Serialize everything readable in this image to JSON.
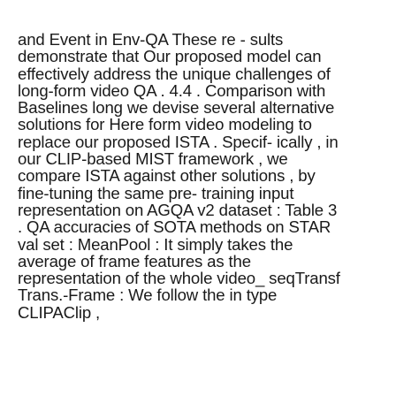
{
  "document": {
    "lines": [
      "and Event in Env-QA These re - sults",
      "demonstrate that Our proposed model can",
      "effectively address the unique challenges of",
      "long-form video QA . 4.4 . Comparison with",
      "Baselines long we devise several alternative",
      "solutions for Here form video modeling to",
      "replace our proposed ISTA . Specif- ically , in",
      "our CLIP-based MIST framework , we",
      "compare ISTA against other solutions , by",
      "fine-tuning the same pre- training input",
      "representation on AGQA v2 dataset : Table 3",
      ". QA accuracies of SOTA methods on STAR",
      "val set : MeanPool : It simply takes the",
      "average of frame features as the",
      "representation of the whole video_ seqTransf",
      "Trans.-Frame : We follow the in type",
      "CLIPAClip ,"
    ]
  }
}
